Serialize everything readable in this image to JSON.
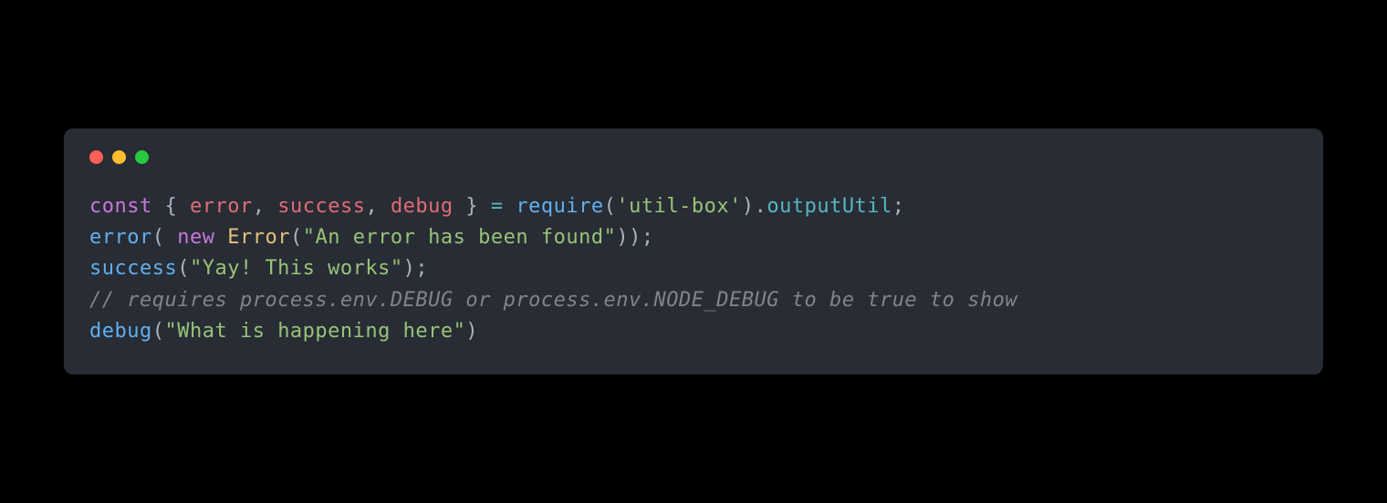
{
  "window": {
    "controls": [
      "close",
      "minimize",
      "zoom"
    ]
  },
  "code": {
    "lines": [
      [
        {
          "cls": "tk-keyword",
          "t": "const"
        },
        {
          "cls": "tk-plain",
          "t": " "
        },
        {
          "cls": "tk-punct",
          "t": "{ "
        },
        {
          "cls": "tk-variable",
          "t": "error"
        },
        {
          "cls": "tk-punct",
          "t": ", "
        },
        {
          "cls": "tk-variable",
          "t": "success"
        },
        {
          "cls": "tk-punct",
          "t": ", "
        },
        {
          "cls": "tk-variable",
          "t": "debug"
        },
        {
          "cls": "tk-punct",
          "t": " } "
        },
        {
          "cls": "tk-operator",
          "t": "="
        },
        {
          "cls": "tk-plain",
          "t": " "
        },
        {
          "cls": "tk-func",
          "t": "require"
        },
        {
          "cls": "tk-punct",
          "t": "("
        },
        {
          "cls": "tk-string",
          "t": "'util-box'"
        },
        {
          "cls": "tk-punct",
          "t": ")."
        },
        {
          "cls": "tk-property",
          "t": "outputUtil"
        },
        {
          "cls": "tk-punct",
          "t": ";"
        }
      ],
      [
        {
          "cls": "tk-func",
          "t": "error"
        },
        {
          "cls": "tk-punct",
          "t": "( "
        },
        {
          "cls": "tk-keyword",
          "t": "new"
        },
        {
          "cls": "tk-plain",
          "t": " "
        },
        {
          "cls": "tk-class",
          "t": "Error"
        },
        {
          "cls": "tk-punct",
          "t": "("
        },
        {
          "cls": "tk-string",
          "t": "\"An error has been found\""
        },
        {
          "cls": "tk-punct",
          "t": "));"
        }
      ],
      [
        {
          "cls": "tk-func",
          "t": "success"
        },
        {
          "cls": "tk-punct",
          "t": "("
        },
        {
          "cls": "tk-string",
          "t": "\"Yay! This works\""
        },
        {
          "cls": "tk-punct",
          "t": ");"
        }
      ],
      [
        {
          "cls": "tk-comment",
          "t": "// requires process.env.DEBUG or process.env.NODE_DEBUG to be true to show"
        }
      ],
      [
        {
          "cls": "tk-func",
          "t": "debug"
        },
        {
          "cls": "tk-punct",
          "t": "("
        },
        {
          "cls": "tk-string",
          "t": "\"What is happening here\""
        },
        {
          "cls": "tk-punct",
          "t": ")"
        }
      ]
    ]
  }
}
